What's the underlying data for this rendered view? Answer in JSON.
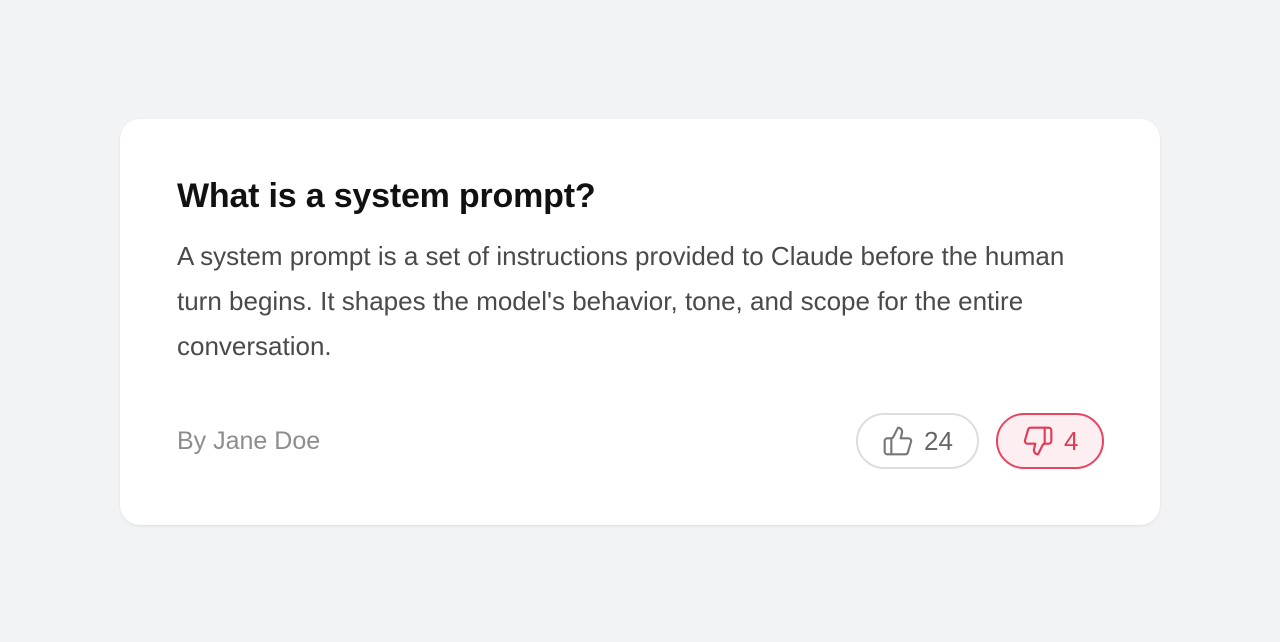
{
  "card": {
    "title": "What is a system prompt?",
    "body": "A system prompt is a set of instructions provided to Claude before the human turn begins. It shapes the model's behavior, tone, and scope for the entire conversation.",
    "author": "By Jane Doe"
  },
  "votes": {
    "up": {
      "count": "24",
      "icon": "thumbs-up-icon"
    },
    "down": {
      "count": "4",
      "icon": "thumbs-down-icon",
      "active": true
    }
  },
  "colors": {
    "background": "#f2f3f5",
    "card": "#ffffff",
    "accent": "#e23a55"
  }
}
